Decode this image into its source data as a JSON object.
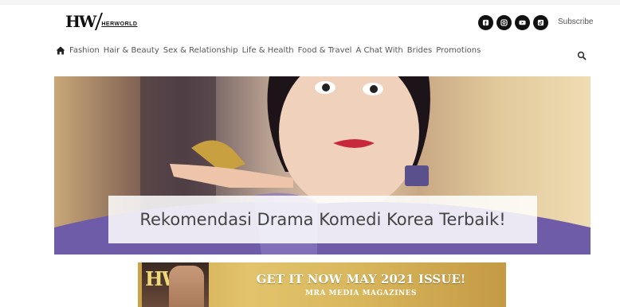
{
  "header": {
    "logo_mark": "HW",
    "logo_word": "HERWORLD",
    "social_icons": [
      "facebook-icon",
      "instagram-icon",
      "youtube-icon",
      "tiktok-icon"
    ],
    "subscribe_label": "Subscribe"
  },
  "nav": {
    "items": [
      {
        "label": "Fashion"
      },
      {
        "label": "Hair & Beauty"
      },
      {
        "label": "Sex & Relationship"
      },
      {
        "label": "Life & Health"
      },
      {
        "label": "Food & Travel"
      },
      {
        "label": "A Chat With"
      },
      {
        "label": "Brides"
      },
      {
        "label": "Promotions"
      }
    ]
  },
  "hero": {
    "caption": "Rekomendasi Drama Komedi Korea Terbaik!"
  },
  "banner": {
    "cover_mark": "HW",
    "headline": "GET IT NOW MAY 2021 ISSUE!",
    "subline": "MRA MEDIA MAGAZINES"
  },
  "colors": {
    "text": "#555555",
    "icon_bg": "#111111",
    "banner_gold": "#d8b65c"
  }
}
